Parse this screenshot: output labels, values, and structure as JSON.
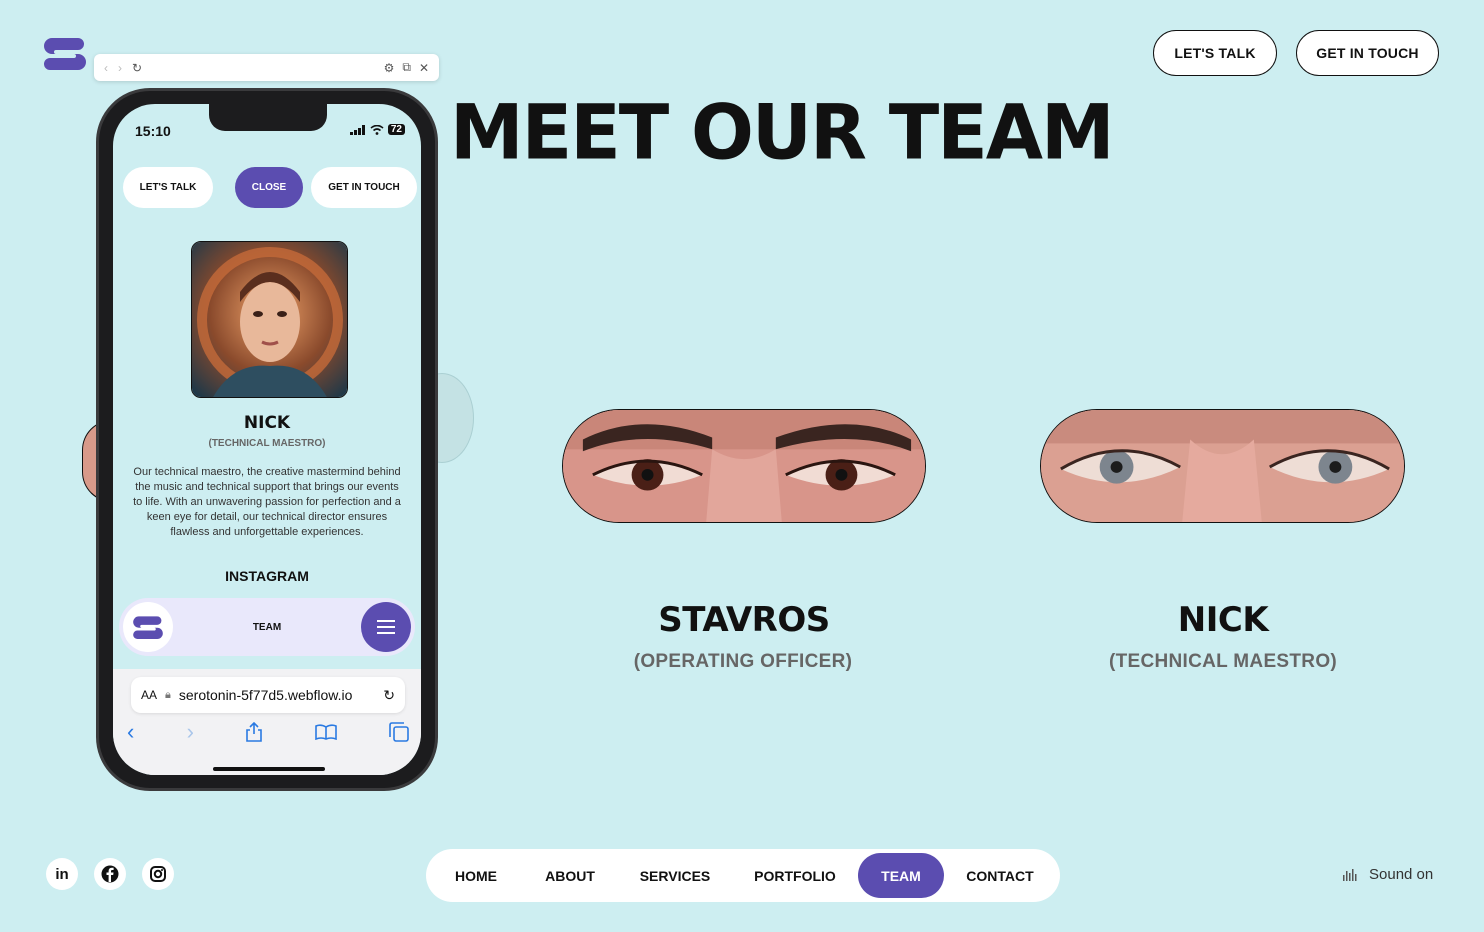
{
  "header": {
    "title": "MEET OUR TEAM",
    "lets_talk": "LET'S TALK",
    "get_in_touch": "GET IN TOUCH"
  },
  "team": [
    {
      "name": "STAVROS",
      "role": "(OPERATING OFFICER)"
    },
    {
      "name": "NICK",
      "role": "(TECHNICAL MAESTRO)"
    }
  ],
  "nav": {
    "items": [
      "HOME",
      "ABOUT",
      "SERVICES",
      "PORTFOLIO",
      "TEAM",
      "CONTACT"
    ],
    "active": "TEAM"
  },
  "sound_label": "Sound on",
  "social": [
    "linkedin-icon",
    "facebook-icon",
    "instagram-icon"
  ],
  "phone": {
    "time": "15:10",
    "battery": "72",
    "lets_talk": "LET'S TALK",
    "close": "CLOSE",
    "get_in_touch": "GET IN TOUCH",
    "member_name": "NICK",
    "member_role": "(TECHNICAL MAESTRO)",
    "description": "Our technical maestro, the creative mastermind behind the music and technical support that brings our events to life. With an unwavering passion for perfection and a keen eye for detail, our technical director ensures flawless and unforgettable experiences.",
    "instagram": "INSTAGRAM",
    "nav_label": "TEAM",
    "text_size": "AA",
    "url": "serotonin-5f77d5.webflow.io"
  },
  "colors": {
    "background": "#cdeef1",
    "accent": "#5b4db0"
  }
}
